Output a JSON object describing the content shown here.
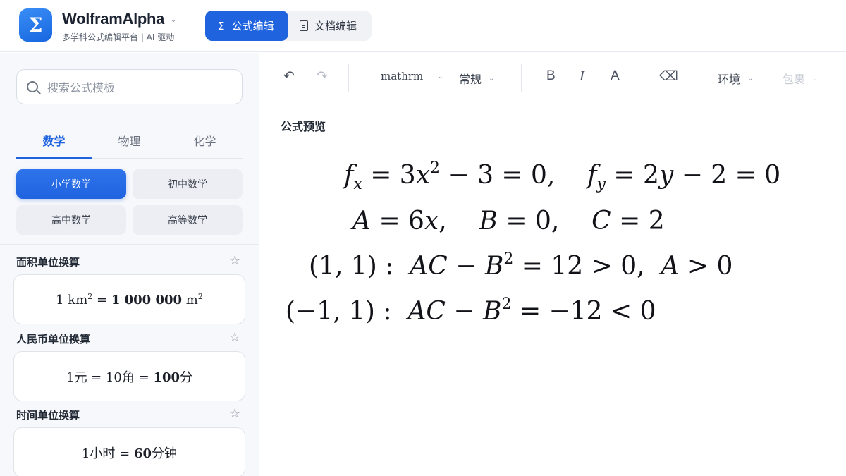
{
  "header": {
    "logo_glyph": "Σ",
    "app_title": "WolframAlpha",
    "app_subtitle": "多学科公式编辑平台 | AI 驱动",
    "modes": [
      {
        "label": "公式编辑",
        "icon": "sigma-icon",
        "active": true
      },
      {
        "label": "文档编辑",
        "icon": "document-icon",
        "active": false
      }
    ]
  },
  "sidebar": {
    "search_placeholder": "搜索公式模板",
    "tabs": [
      "数学",
      "物理",
      "化学"
    ],
    "active_tab": "数学",
    "grades": [
      "小学数学",
      "初中数学",
      "高中数学",
      "高等数学"
    ],
    "active_grade": "小学数学",
    "sections": [
      {
        "title": "面积单位换算",
        "formula": {
          "left": "1 km",
          "exp": "2",
          "mid": " = ",
          "value": "1 000 000",
          "unit": " m",
          "unit_exp": "2"
        }
      },
      {
        "title": "人民币单位换算",
        "formula": {
          "a": "1元 = 10角 = ",
          "b": "100",
          "c": "分"
        }
      },
      {
        "title": "时间单位换算",
        "formula": {
          "a": "1小时 = ",
          "b": "60",
          "c": "分钟"
        }
      }
    ]
  },
  "toolbar": {
    "font_select": "mathrm",
    "style_select": "常规",
    "environment_select": "环境",
    "wrap_select": "包裹",
    "colors": {
      "accent": "#1f63df",
      "disabled": "#c5cad3"
    }
  },
  "preview": {
    "label": "公式预览",
    "lines": [
      "f_x = 3x^2 − 3 = 0,   f_y = 2y − 2 = 0",
      "A = 6x,   B = 0,   C = 2",
      "(1, 1) :  AC − B^2 = 12 > 0,  A > 0",
      "(−1, 1) :  AC − B^2 = −12 < 0"
    ]
  }
}
